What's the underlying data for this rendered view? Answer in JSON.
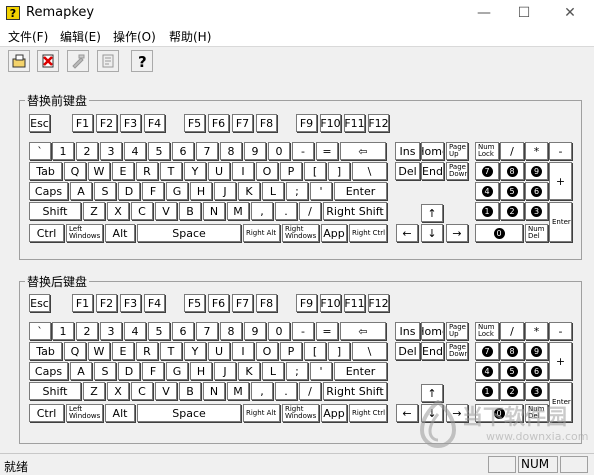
{
  "window": {
    "title": "Remapkey",
    "minimize": "—",
    "maximize": "☐",
    "close": "✕",
    "app_icon_glyph": "?"
  },
  "menu": {
    "items": [
      "文件(F)",
      "编辑(E)",
      "操作(O)",
      "帮助(H)"
    ]
  },
  "toolbar": {
    "buttons": [
      "open-icon",
      "delete-icon",
      "edit-icon",
      "document-icon",
      "help-icon"
    ]
  },
  "before": {
    "label": "替换前键盘",
    "row1": [
      "Esc",
      "F1",
      "F2",
      "F3",
      "F4",
      "F5",
      "F6",
      "F7",
      "F8",
      "F9",
      "F10",
      "F11",
      "F12"
    ],
    "row2": [
      "`",
      "1",
      "2",
      "3",
      "4",
      "5",
      "6",
      "7",
      "8",
      "9",
      "0",
      "-",
      "=",
      "⇦"
    ],
    "row3": [
      "Tab",
      "Q",
      "W",
      "E",
      "R",
      "T",
      "Y",
      "U",
      "I",
      "O",
      "P",
      "[",
      "]",
      "\\"
    ],
    "row4": [
      "Caps",
      "A",
      "S",
      "D",
      "F",
      "G",
      "H",
      "J",
      "K",
      "L",
      ";",
      "'",
      "Enter"
    ],
    "row5": [
      "Shift",
      "Z",
      "X",
      "C",
      "V",
      "B",
      "N",
      "M",
      ",",
      ".",
      "/",
      "Right Shift"
    ],
    "row6": [
      "Ctrl",
      "Left Windows",
      "Alt",
      "Space",
      "Right Alt",
      "Right Windows",
      "App",
      "Right Ctrl"
    ],
    "nav1": [
      "Ins",
      "Home",
      "Page Up"
    ],
    "nav2": [
      "Del",
      "End",
      "Page Down"
    ],
    "arrows": [
      "↑",
      "←",
      "↓",
      "→"
    ],
    "numpad": [
      "Num Lock",
      "/",
      "*",
      "-",
      "7",
      "8",
      "9",
      "+",
      "4",
      "5",
      "6",
      "1",
      "2",
      "3",
      "Enter",
      "0",
      "Num Del"
    ]
  },
  "after": {
    "label": "替换后键盘",
    "row1": [
      "Esc",
      "F1",
      "F2",
      "F3",
      "F4",
      "F5",
      "F6",
      "F7",
      "F8",
      "F9",
      "F10",
      "F11",
      "F12"
    ],
    "row2": [
      "`",
      "1",
      "2",
      "3",
      "4",
      "5",
      "6",
      "7",
      "8",
      "9",
      "0",
      "-",
      "=",
      "⇦"
    ],
    "row3": [
      "Tab",
      "Q",
      "W",
      "E",
      "R",
      "T",
      "Y",
      "U",
      "I",
      "O",
      "P",
      "[",
      "]",
      "\\"
    ],
    "row4": [
      "Caps",
      "A",
      "S",
      "D",
      "F",
      "G",
      "H",
      "J",
      "K",
      "L",
      ";",
      "'",
      "Enter"
    ],
    "row5": [
      "Shift",
      "Z",
      "X",
      "C",
      "V",
      "B",
      "N",
      "M",
      ",",
      ".",
      "/",
      "Right Shift"
    ],
    "row6": [
      "Ctrl",
      "Left Windows",
      "Alt",
      "Space",
      "Right Alt",
      "Right Windows",
      "App",
      "Right Ctrl"
    ],
    "nav1": [
      "Ins",
      "Home",
      "Page Up"
    ],
    "nav2": [
      "Del",
      "End",
      "Page Down"
    ],
    "arrows": [
      "↑",
      "←",
      "↓",
      "→"
    ],
    "numpad": [
      "Num Lock",
      "/",
      "*",
      "-",
      "7",
      "8",
      "9",
      "+",
      "4",
      "5",
      "6",
      "1",
      "2",
      "3",
      "Enter",
      "0",
      "Num Del"
    ]
  },
  "status": {
    "text": "就绪",
    "num": "NUM"
  },
  "watermark": {
    "text": "当下软件园",
    "url": "www.downxia.com"
  }
}
